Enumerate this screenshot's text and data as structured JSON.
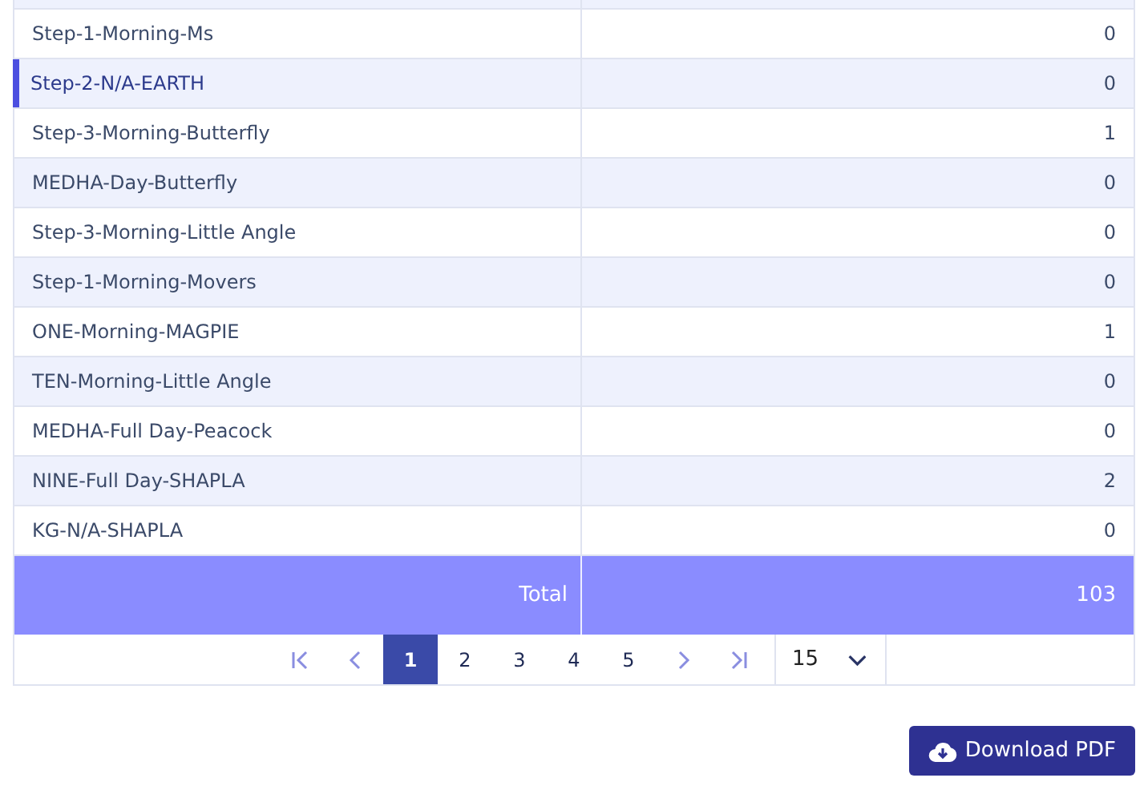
{
  "rows": [
    {
      "name": "Step-1-Morning-Ms",
      "count": "0",
      "selected": false
    },
    {
      "name": "Step-2-N/A-EARTH",
      "count": "0",
      "selected": true
    },
    {
      "name": "Step-3-Morning-Butterfly",
      "count": "1",
      "selected": false
    },
    {
      "name": "MEDHA-Day-Butterfly",
      "count": "0",
      "selected": false
    },
    {
      "name": "Step-3-Morning-Little Angle",
      "count": "0",
      "selected": false
    },
    {
      "name": "Step-1-Morning-Movers",
      "count": "0",
      "selected": false
    },
    {
      "name": "ONE-Morning-MAGPIE",
      "count": "1",
      "selected": false
    },
    {
      "name": "TEN-Morning-Little Angle",
      "count": "0",
      "selected": false
    },
    {
      "name": "MEDHA-Full Day-Peacock",
      "count": "0",
      "selected": false
    },
    {
      "name": "NINE-Full Day-SHAPLA",
      "count": "2",
      "selected": false
    },
    {
      "name": "KG-N/A-SHAPLA",
      "count": "0",
      "selected": false
    }
  ],
  "total": {
    "label": "Total",
    "value": "103"
  },
  "pagination": {
    "pages": [
      {
        "label": "1",
        "selected": true
      },
      {
        "label": "2",
        "selected": false
      },
      {
        "label": "3",
        "selected": false
      },
      {
        "label": "4",
        "selected": false
      },
      {
        "label": "5",
        "selected": false
      }
    ],
    "page_size": "15"
  },
  "download_button": "Download PDF"
}
